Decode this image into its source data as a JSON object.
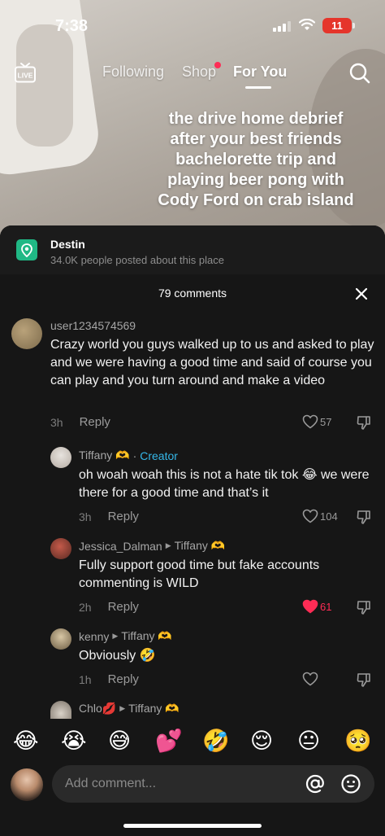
{
  "status_bar": {
    "time": "7:38",
    "battery": "11"
  },
  "nav": {
    "live_label": "LIVE",
    "following": "Following",
    "shop": "Shop",
    "for_you": "For You"
  },
  "video": {
    "caption": "the drive home debrief after your best friends bachelorette trip and playing beer pong with Cody Ford on crab island"
  },
  "place": {
    "name": "Destin",
    "subtitle": "34.0K people posted about this place"
  },
  "comments_header": "79 comments",
  "comments": [
    {
      "user": "user1234574569",
      "text": "Crazy world you guys walked up to us and asked to play and we were having a good time and said of course you can play and you turn around and make a video",
      "time": "3h",
      "reply_label": "Reply",
      "likes": "57",
      "liked": false
    },
    {
      "user": "Tiffany 🫶",
      "separator": "·",
      "badge": "Creator",
      "text": "oh woah woah this is not a hate tik tok 😂 we were there for a good time and that’s it",
      "time": "3h",
      "reply_label": "Reply",
      "likes": "104",
      "liked": false
    },
    {
      "user": "Jessica_Dalman",
      "reply_to": "Tiffany 🫶",
      "text": "Fully support good time but fake accounts commenting is WILD",
      "time": "2h",
      "reply_label": "Reply",
      "likes": "61",
      "liked": true
    },
    {
      "user": "kenny",
      "reply_to": "Tiffany 🫶",
      "text": "Obviously 🤣",
      "time": "1h",
      "reply_label": "Reply",
      "likes": "",
      "liked": false
    },
    {
      "user": "Chlo💋",
      "reply_to": "Tiffany 🫶"
    }
  ],
  "emoji_bar": [
    "😂",
    "😭",
    "😅",
    "💕",
    "🤣",
    "😌",
    "😐",
    "🥺"
  ],
  "composer": {
    "placeholder": "Add comment..."
  },
  "colors": {
    "accent_red": "#fe2c55",
    "creator_blue": "#35b7e8",
    "place_green": "#20b885",
    "sheet_bg": "#161616"
  }
}
